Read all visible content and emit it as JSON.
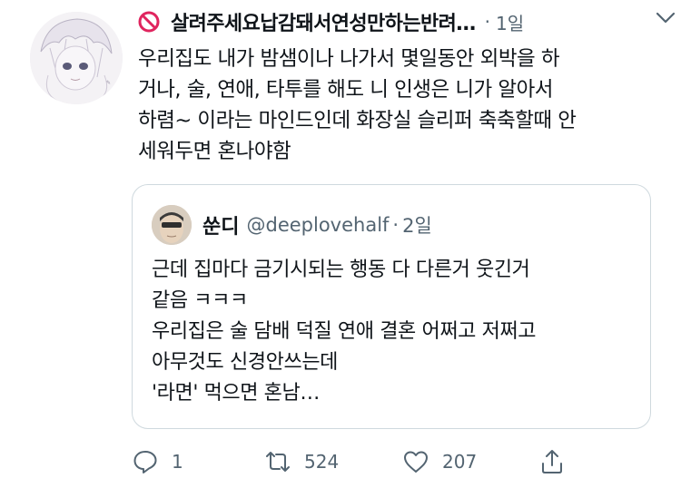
{
  "tweet": {
    "display_name": "살려주세요납감돼서연성만하는반려…",
    "separator": "·",
    "time": "1일",
    "lines": [
      "우리집도 내가 밤샘이나 나가서 몇일동안 외박을 하",
      "거나, 술, 연애, 타투를 해도 니 인생은 니가 알아서",
      "하렴~ 이라는 마인드인데 화장실 슬리퍼 축축할때 안",
      "세워두면 혼나야함"
    ]
  },
  "quote": {
    "display_name": "쑨디",
    "handle": "@deeplovehalf",
    "separator": "·",
    "time": "2일",
    "lines": [
      "근데 집마다 금기시되는 행동 다 다른거 웃긴거",
      "같음 ㅋㅋㅋ",
      "우리집은 술 담배 덕질 연애 결혼 어쩌고 저쩌고",
      "아무것도 신경안쓰는데",
      "'라면' 먹으면 혼남…"
    ]
  },
  "actions": {
    "reply_count": "1",
    "retweet_count": "524",
    "like_count": "207"
  },
  "colors": {
    "prohibited": "#e0245e",
    "secondary_text": "#536471",
    "border": "#cfd9de"
  },
  "icons": [
    "prohibited-icon",
    "more-icon",
    "reply-icon",
    "retweet-icon",
    "like-icon",
    "share-icon"
  ]
}
